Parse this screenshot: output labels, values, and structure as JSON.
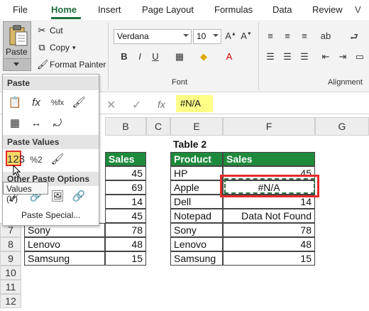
{
  "menu": {
    "tabs": [
      "File",
      "Home",
      "Insert",
      "Page Layout",
      "Formulas",
      "Data",
      "Review"
    ],
    "active": "Home"
  },
  "clipboard": {
    "paste_label": "Paste",
    "cut_label": "Cut",
    "copy_label": "Copy",
    "format_painter_label": "Format Painter"
  },
  "font_group": {
    "font_name": "Verdana",
    "font_size": "10",
    "label": "Font"
  },
  "alignment_group": {
    "label": "Alignment"
  },
  "formula_bar": {
    "fx": "fx",
    "content": "#N/A"
  },
  "columns": [
    "B",
    "C",
    "E",
    "F",
    "G"
  ],
  "rows": [
    "7",
    "8",
    "9",
    "10",
    "11",
    "12"
  ],
  "table1": {
    "header_sales": "Sales",
    "partial_rows": [
      {
        "value": "45"
      },
      {
        "value": "69"
      },
      {
        "value": "14"
      },
      {
        "value": "45"
      }
    ],
    "rows": [
      {
        "product": "Sony",
        "sales": "78"
      },
      {
        "product": "Lenovo",
        "sales": "48"
      },
      {
        "product": "Samsung",
        "sales": "15"
      }
    ]
  },
  "table2": {
    "title": "Table 2",
    "header_product": "Product",
    "header_sales": "Sales",
    "rows": [
      {
        "product": "HP",
        "sales": "45"
      },
      {
        "product": "Apple",
        "sales": "#N/A"
      },
      {
        "product": "Dell",
        "sales": "14"
      },
      {
        "product": "Notepad",
        "sales": "Data Not Found"
      },
      {
        "product": "Sony",
        "sales": "78"
      },
      {
        "product": "Lenovo",
        "sales": "48"
      },
      {
        "product": "Samsung",
        "sales": "15"
      }
    ]
  },
  "paste_menu": {
    "section_paste": "Paste",
    "section_paste_values": "Paste Values",
    "section_other": "Other Paste Options",
    "tooltip": "Values (V)",
    "paste_special": "Paste Special...",
    "values_icon_label": "%2"
  },
  "colors": {
    "accent": "#1e6e3c",
    "header_green": "#1e8a3c",
    "highlight_red": "#e52b2b",
    "formula_yellow": "#ffff88"
  }
}
